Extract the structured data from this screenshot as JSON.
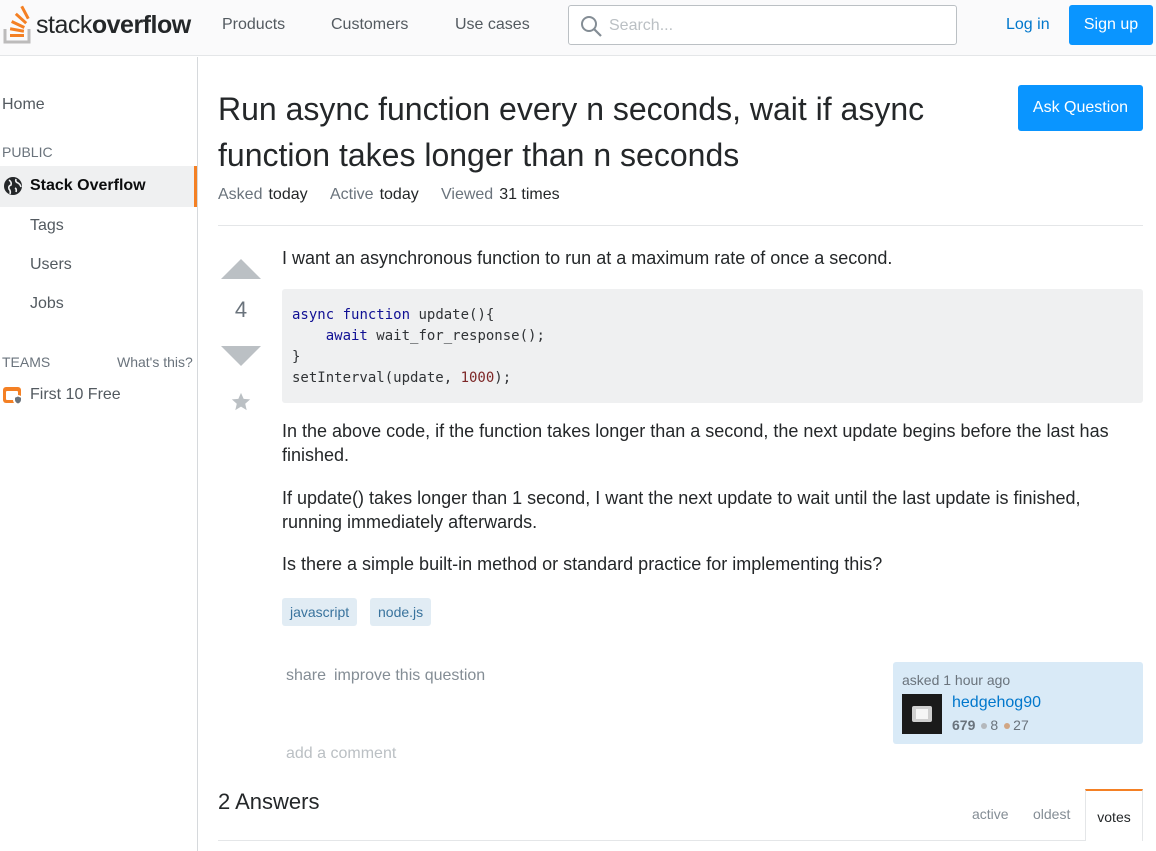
{
  "brand": {
    "logo_prefix": "stack",
    "logo_suffix": "overflow",
    "accent_color": "#f48024",
    "primary_color": "#0a95ff"
  },
  "topnav": {
    "products": "Products",
    "customers": "Customers",
    "use_cases": "Use cases"
  },
  "search": {
    "placeholder": "Search...",
    "value": "",
    "icon": "search-icon"
  },
  "auth": {
    "login": "Log in",
    "signup": "Sign up"
  },
  "sidebar": {
    "home": "Home",
    "public_heading": "PUBLIC",
    "active_item": {
      "label": "Stack Overflow",
      "icon": "globe-icon"
    },
    "items": [
      "Tags",
      "Users",
      "Jobs"
    ],
    "teams_heading": "TEAMS",
    "whats_this": "What's this?",
    "teams_item": {
      "label": "First 10 Free",
      "icon": "briefcase-icon"
    }
  },
  "question": {
    "title": "Run async function every n seconds, wait if async function takes longer than n seconds",
    "ask_button": "Ask Question",
    "meta": {
      "asked_label": "Asked",
      "asked_value": "today",
      "active_label": "Active",
      "active_value": "today",
      "viewed_label": "Viewed",
      "viewed_value": "31 times"
    },
    "votes": "4",
    "body": {
      "p1": "I want an asynchronous function to run at a maximum rate of once a second.",
      "code": {
        "kw_async": "async",
        "kw_function": "function",
        "fn_sig": " update(){",
        "kw_await": "await",
        "await_call": " wait_for_response();",
        "close_brace": "}",
        "interval_prefix": "setInterval(update, ",
        "interval_num": "1000",
        "interval_suffix": ");"
      },
      "p2": "In the above code, if the function takes longer than a second, the next update begins before the last has finished.",
      "p3": "If update() takes longer than 1 second, I want the next update to wait until the last update is finished, running immediately afterwards.",
      "p4": "Is there a simple built-in method or standard practice for implementing this?"
    },
    "tags": [
      "javascript",
      "node.js"
    ],
    "menu": {
      "share": "share",
      "improve": "improve this question"
    },
    "owner": {
      "asked_time": "asked 1 hour ago",
      "name": "hedgehog90",
      "reputation": "679",
      "silver_badges": "8",
      "bronze_badges": "27"
    },
    "add_comment": "add a comment"
  },
  "answers": {
    "heading": "2 Answers",
    "tabs": [
      "active",
      "oldest",
      "votes"
    ],
    "selected_tab": "votes"
  }
}
